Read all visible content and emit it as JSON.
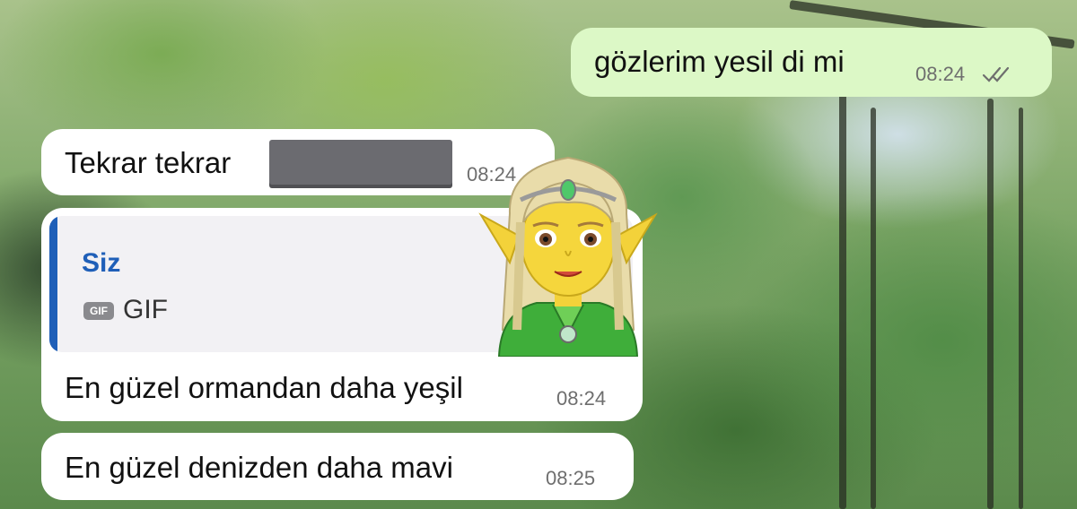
{
  "messages": {
    "m1": {
      "text": "gözlerim yesil di mi",
      "time": "08:24",
      "status_icon": "double-check-icon"
    },
    "m2": {
      "text": "Tekrar tekrar",
      "time": "08:24"
    },
    "m3": {
      "reply_to": {
        "author": "Siz",
        "badge": "GIF",
        "type_label": "GIF"
      },
      "sticker": "elf-woman-emoji",
      "text": "En güzel ormandan daha yeşil",
      "time": "08:24"
    },
    "m4": {
      "text": "En güzel denizden daha mavi",
      "time": "08:25"
    }
  },
  "colors": {
    "incoming_bubble": "#ffffff",
    "outgoing_bubble": "#dcf8c6",
    "quote_accent": "#1f5fb8"
  }
}
